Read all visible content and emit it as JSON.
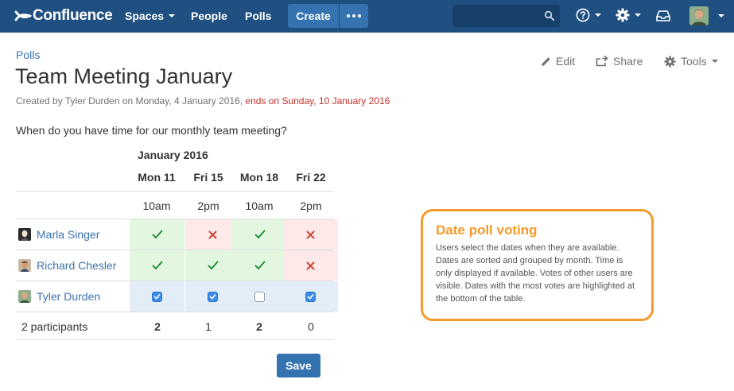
{
  "nav": {
    "logo_text": "Confluence",
    "spaces": "Spaces",
    "people": "People",
    "polls": "Polls",
    "create": "Create",
    "help_icon": "help-icon",
    "settings_icon": "gear-icon",
    "notifications_icon": "inbox-icon",
    "brand_color": "#205081",
    "button_color": "#3572b0"
  },
  "page": {
    "breadcrumb": "Polls",
    "title": "Team Meeting January",
    "byline_created": "Created by Tyler Durden on Monday, 4 January 2016,",
    "byline_ends": "ends on Sunday, 10 January 2016",
    "actions": {
      "edit": "Edit",
      "share": "Share",
      "tools": "Tools"
    }
  },
  "poll": {
    "question": "When do you have time for our monthly team meeting?",
    "month": "January 2016",
    "dates": [
      {
        "day": "Mon 11",
        "time": "10am"
      },
      {
        "day": "Fri 15",
        "time": "2pm"
      },
      {
        "day": "Mon 18",
        "time": "10am"
      },
      {
        "day": "Fri 22",
        "time": "2pm"
      }
    ],
    "participants": [
      {
        "name": "Marla Singer",
        "votes": [
          "yes",
          "no",
          "yes",
          "no"
        ]
      },
      {
        "name": "Richard Chesler",
        "votes": [
          "yes",
          "yes",
          "yes",
          "no"
        ]
      },
      {
        "name": "Tyler Durden",
        "votes": [
          true,
          true,
          false,
          true
        ]
      }
    ],
    "participants_label": "2 participants",
    "counts": [
      "2",
      "1",
      "2",
      "0"
    ],
    "save": "Save",
    "colors": {
      "yes": "#e3f7e0",
      "no": "#fde9e8",
      "own_row": "#e2edf8",
      "check": "#14892c",
      "cross": "#d04437"
    }
  },
  "callout": {
    "title": "Date poll voting",
    "body": "Users select the dates when they are available. Dates are sorted and grouped by month. Time is only displayed if available. Votes of other users are visible. Dates with the most votes are highlighted at the bottom of the table.",
    "color": "#f59a2b"
  }
}
